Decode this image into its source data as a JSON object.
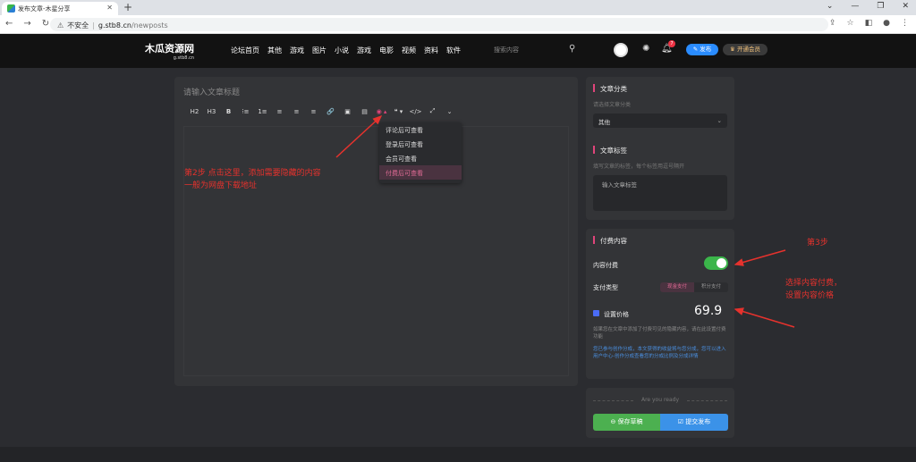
{
  "browser": {
    "tab_title": "发布文章-木星分享",
    "url_warning": "不安全",
    "url_host": "g.stb8.cn",
    "url_path": "/newposts"
  },
  "site": {
    "logo": "木瓜资源网",
    "logo_sub": "g.stb8.cn",
    "nav": [
      "论坛首页",
      "其他",
      "游戏",
      "图片",
      "小说",
      "游戏",
      "电影",
      "视频",
      "资料",
      "软件"
    ],
    "search_placeholder": "搜索内容",
    "bell_count": "7",
    "publish_label": "发布",
    "vip_label": "开通会员"
  },
  "editor": {
    "title_placeholder": "请输入文章标题",
    "toolbar": [
      "H2",
      "H3",
      "B",
      "⁝≡",
      "1≡",
      "≡",
      "≡",
      "≡",
      "🔗",
      "▣",
      "▤",
      "◉ ▴",
      "❝ ▾",
      "</>",
      "⤢",
      "⌄"
    ],
    "dropdown": [
      "评论后可查看",
      "登录后可查看",
      "会员可查看",
      "付费后可查看"
    ]
  },
  "annotations": {
    "step2_line1": "第2步 点击这里，添加需要隐藏的内容",
    "step2_line2": "一般为网盘下载地址",
    "step3": "第3步",
    "step3_desc_line1": "选择内容付费，",
    "step3_desc_line2": "设置内容价格"
  },
  "category_panel": {
    "title": "文章分类",
    "hint": "请选择文章分类",
    "selected": "其他"
  },
  "tag_panel": {
    "title": "文章标签",
    "hint": "填写文章的标签，每个标签用逗号隔开",
    "placeholder": "输入文章标签"
  },
  "paid_panel": {
    "title": "付费内容",
    "paid_label": "内容付费",
    "paid_on": true,
    "paytype_label": "支付类型",
    "paytype_cash": "现金支付",
    "paytype_points": "积分支付",
    "price_label": "设置价格",
    "price": "69.9",
    "note": "如果您在文章中添加了付费可见的隐藏内容，请在此设置付费功能",
    "note_link": "您已参与创作分成，本文获得的收益将与您分成，您可以进入用户中心-创作分成查看您的分成比例及分成详情"
  },
  "submit_panel": {
    "ready": "Are you ready",
    "save": "保存草稿",
    "submit": "提交发布"
  },
  "colors": {
    "accent_pink": "#e0457b",
    "arrow_red": "#e6322d",
    "toggle_green": "#3bb54a",
    "save_green": "#4cb050",
    "submit_blue": "#3b92e8"
  }
}
